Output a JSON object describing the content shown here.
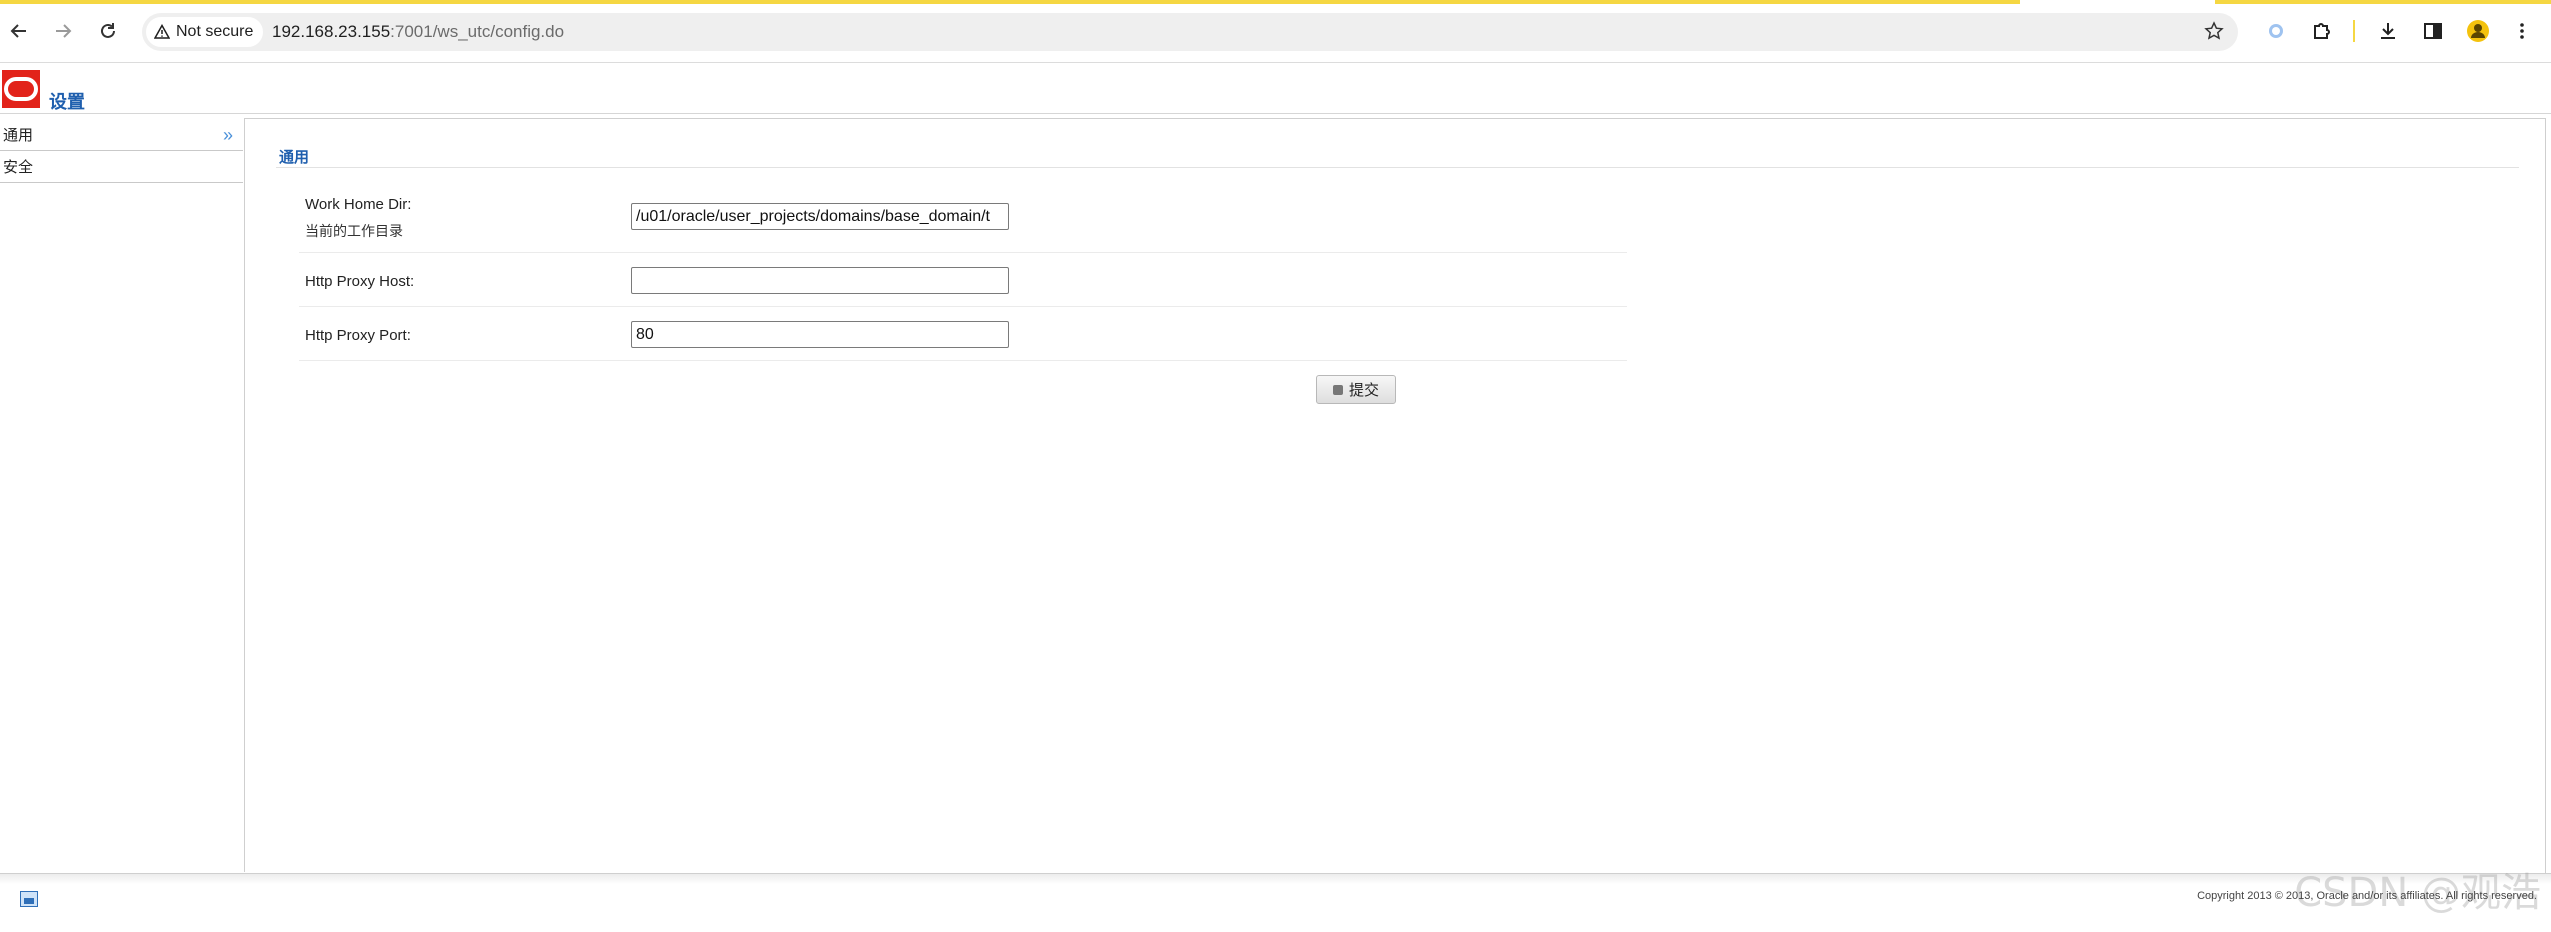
{
  "browser": {
    "security_label": "Not secure",
    "url_host": "192.168.23.155",
    "url_path": ":7001/ws_utc/config.do",
    "icons": [
      "back-icon",
      "forward-icon",
      "reload-icon",
      "warning-icon",
      "star-icon",
      "extension-icon",
      "puzzle-icon",
      "download-icon",
      "sidepanel-icon",
      "profile-icon",
      "menu-icon"
    ]
  },
  "app": {
    "title": "设置",
    "brand_color": "#e2231a",
    "accent_color": "#1f5fae"
  },
  "sidebar": {
    "items": [
      {
        "label": "通用",
        "active": true
      },
      {
        "label": "安全",
        "active": false
      }
    ]
  },
  "section": {
    "title": "通用"
  },
  "form": {
    "work_home_dir": {
      "label": "Work Home Dir:",
      "sublabel": "当前的工作目录",
      "value": "/u01/oracle/user_projects/domains/base_domain/t"
    },
    "http_proxy_host": {
      "label": "Http Proxy Host:",
      "value": ""
    },
    "http_proxy_port": {
      "label": "Http Proxy Port:",
      "value": "80"
    },
    "submit_label": "提交"
  },
  "footer": {
    "copyright": "Copyright 2013 © 2013, Oracle and/or its affiliates. All rights reserved.",
    "watermark": "CSDN @观浩"
  }
}
